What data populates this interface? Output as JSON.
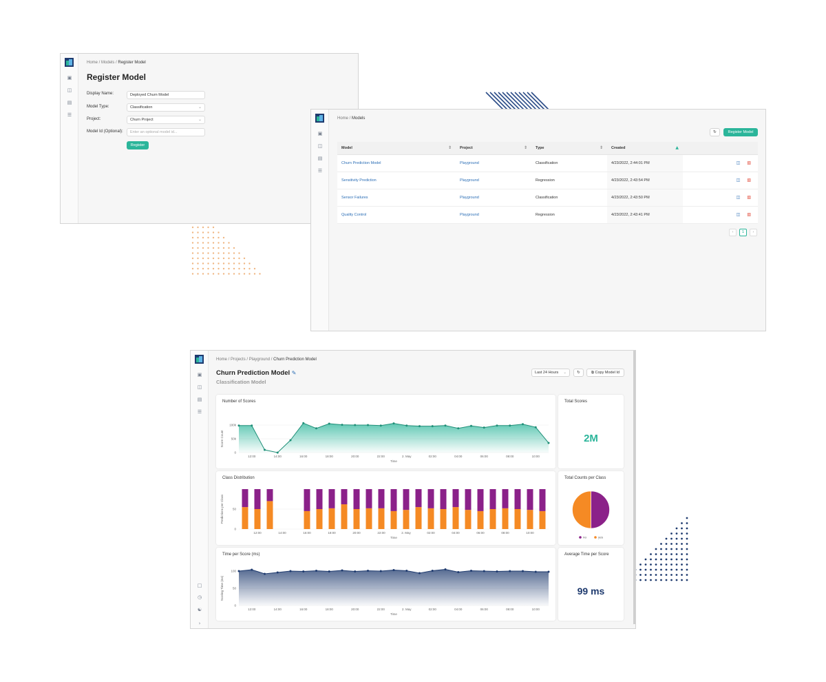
{
  "register": {
    "breadcrumb": [
      "Home",
      "Models",
      "Register Model"
    ],
    "title": "Register Model",
    "display_name_label": "Display Name:",
    "display_name_value": "Deployed Churn Model",
    "model_type_label": "Model Type:",
    "model_type_value": "Classification",
    "project_label": "Project:",
    "project_value": "Churn Project",
    "model_id_label": "Model Id (Optional):",
    "model_id_placeholder": "Enter an optional model id...",
    "register_button": "Register"
  },
  "models": {
    "breadcrumb": [
      "Home",
      "Models"
    ],
    "register_button": "Register Model",
    "columns": [
      "Model",
      "Project",
      "Type",
      "Created"
    ],
    "rows": [
      {
        "model": "Churn Prediction Model",
        "project": "Playground",
        "type": "Classification",
        "created": "4/23/2022, 2:44:01 PM"
      },
      {
        "model": "Sensitivity Prediction",
        "project": "Playground",
        "type": "Regression",
        "created": "4/23/2022, 2:43:54 PM"
      },
      {
        "model": "Sensor Failures",
        "project": "Playground",
        "type": "Classification",
        "created": "4/23/2022, 2:43:50 PM"
      },
      {
        "model": "Quality Control",
        "project": "Playground",
        "type": "Regression",
        "created": "4/23/2022, 2:43:41 PM"
      }
    ],
    "page": "1"
  },
  "dashboard": {
    "breadcrumb": [
      "Home",
      "Projects",
      "Playground",
      "Churn Prediction Model"
    ],
    "title": "Churn Prediction Model",
    "subtitle": "Classification Model",
    "range_select": "Last 24 Hours",
    "copy_button": "Copy Model Id",
    "total_scores_title": "Total Scores",
    "total_scores_value": "2M",
    "counts_title": "Total Counts per Class",
    "avg_time_title": "Average Time per Score",
    "avg_time_value": "99 ms"
  },
  "colors": {
    "accent": "#2bb59a",
    "purple": "#8b2189",
    "orange": "#f58a24",
    "navy": "#1e3a6e",
    "link": "#2a6db5"
  },
  "chart_data": [
    {
      "type": "area",
      "title": "Number of Scores",
      "xlabel": "Time",
      "ylabel": "Score Count",
      "ylim": [
        0,
        100000
      ],
      "yticks": [
        "0",
        "50k",
        "100k"
      ],
      "xticks": [
        "12:00",
        "14:00",
        "16:00",
        "18:00",
        "20:00",
        "22:00",
        "2. May",
        "02:00",
        "04:00",
        "06:00",
        "08:00",
        "10:00"
      ],
      "x": [
        "11:00",
        "12:00",
        "13:00",
        "14:00",
        "15:00",
        "16:00",
        "17:00",
        "18:00",
        "19:00",
        "20:00",
        "21:00",
        "22:00",
        "23:00",
        "00:00",
        "01:00",
        "02:00",
        "03:00",
        "04:00",
        "05:00",
        "06:00",
        "07:00",
        "08:00",
        "09:00",
        "10:00",
        "11:00"
      ],
      "values": [
        98000,
        98000,
        10000,
        0,
        45000,
        107000,
        88000,
        105000,
        101000,
        100000,
        100000,
        98000,
        106000,
        98000,
        96000,
        96000,
        98000,
        88000,
        97000,
        91000,
        98000,
        98000,
        103000,
        92000,
        35000
      ]
    },
    {
      "type": "bar",
      "title": "Class Distribution",
      "xlabel": "Time",
      "ylabel": "Predictions per Class",
      "ylim": [
        0,
        100
      ],
      "yticks": [
        "0",
        "50"
      ],
      "xticks": [
        "12:00",
        "14:00",
        "16:00",
        "18:00",
        "20:00",
        "22:00",
        "2. May",
        "02:00",
        "04:00",
        "06:00",
        "08:00",
        "10:00"
      ],
      "categories": [
        "11:00",
        "12:00",
        "13:00",
        "14:00",
        "15:00",
        "16:00",
        "17:00",
        "18:00",
        "19:00",
        "20:00",
        "21:00",
        "22:00",
        "23:00",
        "00:00",
        "01:00",
        "02:00",
        "03:00",
        "04:00",
        "05:00",
        "06:00",
        "07:00",
        "08:00",
        "09:00",
        "10:00",
        "11:00"
      ],
      "series": [
        {
          "name": "yes",
          "values": [
            55,
            50,
            70,
            0,
            0,
            45,
            50,
            52,
            62,
            50,
            52,
            52,
            45,
            48,
            55,
            52,
            50,
            55,
            48,
            45,
            50,
            52,
            50,
            48,
            45
          ]
        },
        {
          "name": "no",
          "values": [
            45,
            50,
            30,
            0,
            0,
            55,
            50,
            48,
            38,
            50,
            48,
            48,
            55,
            52,
            45,
            48,
            50,
            45,
            52,
            55,
            50,
            48,
            50,
            52,
            55
          ]
        }
      ]
    },
    {
      "type": "pie",
      "title": "Total Counts per Class",
      "categories": [
        "no",
        "yes"
      ],
      "values": [
        50,
        50
      ]
    },
    {
      "type": "area",
      "title": "Time per Score (ms)",
      "xlabel": "Time",
      "ylabel": "Scoring Time (ms)",
      "ylim": [
        0,
        100
      ],
      "yticks": [
        "0",
        "50",
        "100"
      ],
      "xticks": [
        "12:00",
        "14:00",
        "16:00",
        "18:00",
        "20:00",
        "22:00",
        "2. May",
        "02:00",
        "04:00",
        "06:00",
        "08:00",
        "10:00"
      ],
      "x": [
        "11:00",
        "12:00",
        "13:00",
        "14:00",
        "15:00",
        "16:00",
        "17:00",
        "18:00",
        "19:00",
        "20:00",
        "21:00",
        "22:00",
        "23:00",
        "00:00",
        "01:00",
        "02:00",
        "03:00",
        "04:00",
        "05:00",
        "06:00",
        "07:00",
        "08:00",
        "09:00",
        "10:00",
        "11:00"
      ],
      "values": [
        100,
        104,
        92,
        96,
        100,
        99,
        101,
        99,
        102,
        99,
        101,
        100,
        103,
        101,
        94,
        101,
        105,
        97,
        101,
        100,
        99,
        100,
        100,
        98,
        98
      ]
    }
  ]
}
